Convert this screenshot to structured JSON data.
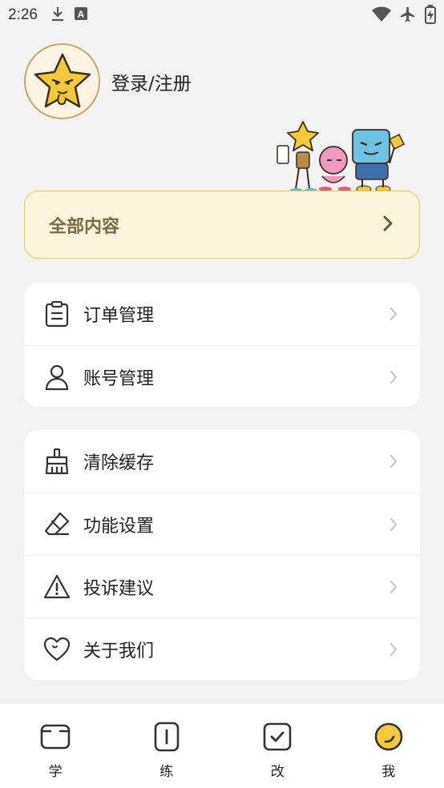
{
  "status_bar": {
    "time": "2:26",
    "icons": [
      "download-icon",
      "keyboard-a-icon",
      "wifi-icon",
      "airplane-icon",
      "battery-charging-icon"
    ]
  },
  "profile": {
    "login_label": "登录/注册",
    "avatar_icon": "star-mascot-avatar"
  },
  "all_content": {
    "label": "全部内容",
    "icon": "chevron-right-icon"
  },
  "menu_group_1": [
    {
      "label": "订单管理",
      "icon": "clipboard-icon"
    },
    {
      "label": "账号管理",
      "icon": "user-icon"
    }
  ],
  "menu_group_2": [
    {
      "label": "清除缓存",
      "icon": "broom-icon"
    },
    {
      "label": "功能设置",
      "icon": "eraser-icon"
    },
    {
      "label": "投诉建议",
      "icon": "warning-icon"
    },
    {
      "label": "关于我们",
      "icon": "heart-icon"
    }
  ],
  "tabbar": [
    {
      "label": "学",
      "icon": "book-icon",
      "active": false
    },
    {
      "label": "练",
      "icon": "practice-icon",
      "active": false
    },
    {
      "label": "改",
      "icon": "check-box-icon",
      "active": false
    },
    {
      "label": "我",
      "icon": "smile-face-icon",
      "active": true
    }
  ],
  "colors": {
    "accent_yellow": "#f5c93a",
    "card_bg": "#fdf5dc",
    "card_border": "#f1cc50",
    "page_bg": "#f3f3f3"
  }
}
